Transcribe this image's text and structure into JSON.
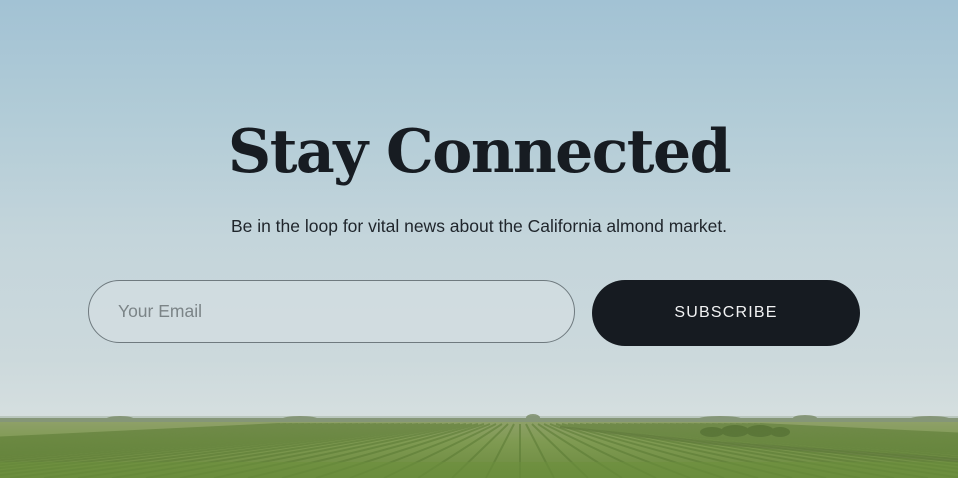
{
  "newsletter": {
    "headline": "Stay Connected",
    "subtitle": "Be in the loop for vital news about the California almond market.",
    "email_placeholder": "Your Email",
    "email_value": "",
    "subscribe_label": "SUBSCRIBE"
  },
  "colors": {
    "headline_text": "#171c22",
    "button_background": "#161b21",
    "button_text": "#f2f3f4",
    "sky_top": "#a2c2d4",
    "sky_bottom": "#d4dedf",
    "field_green": "#7f9a52"
  },
  "background": {
    "image_icon": "almond-orchard-landscape"
  }
}
